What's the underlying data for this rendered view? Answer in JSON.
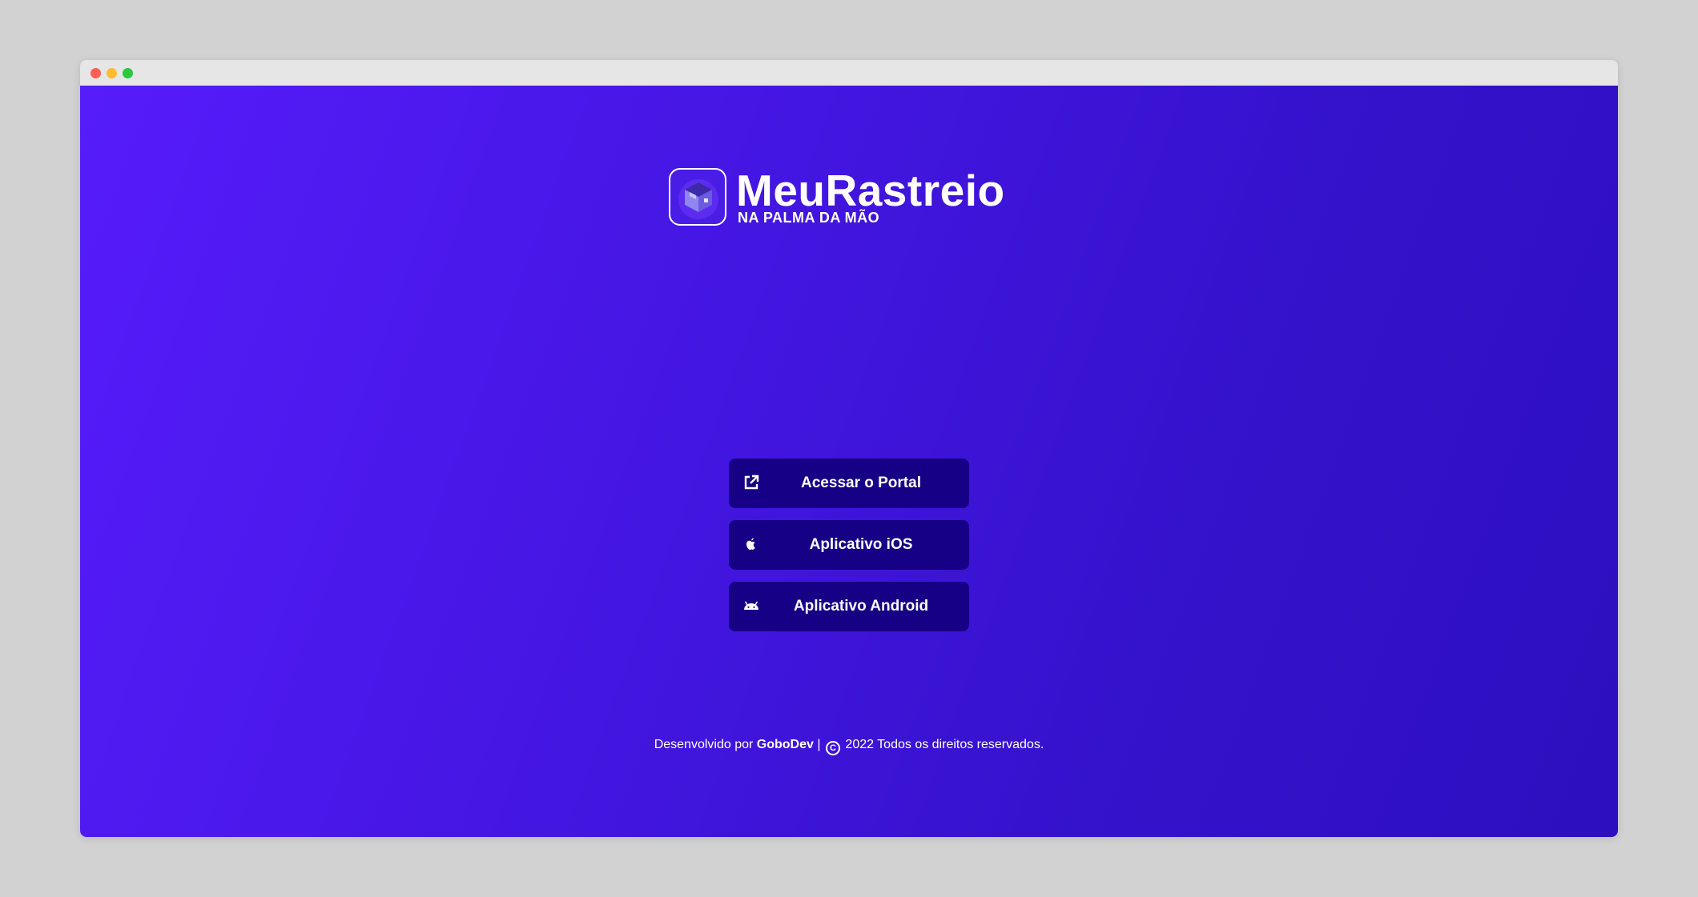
{
  "logo": {
    "title": "MeuRastreio",
    "subtitle": "NA PALMA DA MÃO"
  },
  "buttons": [
    {
      "label": "Acessar o Portal",
      "icon": "external-link-icon"
    },
    {
      "label": "Aplicativo iOS",
      "icon": "apple-icon"
    },
    {
      "label": "Aplicativo Android",
      "icon": "android-icon"
    }
  ],
  "footer": {
    "prefix": "Desenvolvido por",
    "brand": "GoboDev",
    "separator": "|",
    "copyright_symbol": "C",
    "rest": "2022 Todos os direitos reservados."
  },
  "colors": {
    "background_start": "#561cfb",
    "background_end": "#2d0fbf",
    "button": "#160085",
    "text": "#ffffff"
  }
}
